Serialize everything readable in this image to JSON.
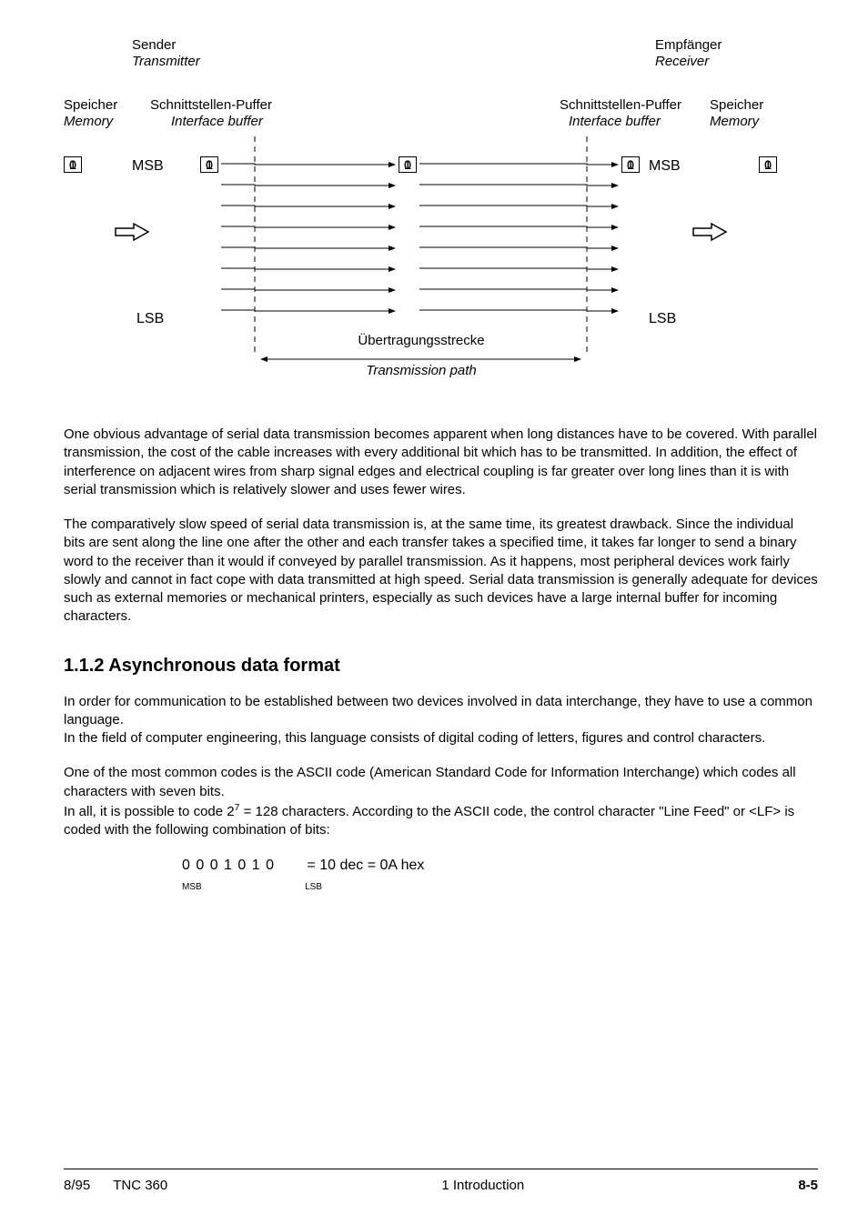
{
  "diagram": {
    "sender_de": "Sender",
    "sender_en": "Transmitter",
    "receiver_de": "Empfänger",
    "receiver_en": "Receiver",
    "memory_de": "Speicher",
    "memory_en": "Memory",
    "buffer_de": "Schnittstellen-Puffer",
    "buffer_en": "Interface buffer",
    "msb": "MSB",
    "lsb": "LSB",
    "path_de": "Übertragungsstrecke",
    "path_en": "Transmission path",
    "bits": [
      "0",
      "1",
      "1",
      "0",
      "1",
      "0",
      "1",
      "1"
    ]
  },
  "para1": "One obvious advantage of serial data transmission becomes apparent when long distances have to be covered. With parallel transmission, the cost of the cable increases with every additional bit which has to be transmitted. In addition, the effect of interference on adjacent wires from sharp signal edges and electrical coupling is far greater over long lines than it is with serial transmission which is relatively slower and uses fewer wires.",
  "para2": "The comparatively slow speed of serial data transmission is, at the same time, its greatest drawback. Since the individual bits are sent along the line one after the other and each transfer takes a specified time, it takes far longer to send a binary word to the receiver than it would if conveyed by parallel transmission. As it happens, most peripheral devices work fairly slowly and cannot in fact cope with data transmitted at high speed. Serial data transmission is generally adequate for devices such as external memories or mechanical printers, especially as such devices have a large internal buffer for incoming characters.",
  "heading": "1.1.2  Asynchronous data format",
  "para3a": "In order for communication to be established between two devices involved in data interchange, they have to use a common language.",
  "para3b": "In the field of computer engineering, this language consists of digital coding of letters, figures and control characters.",
  "para4a": "One of the most common codes is the ASCII code (American Standard Code for Information Interchange) which codes all characters with seven bits.",
  "para4b_pre": "In all, it is possible to code 2",
  "para4b_post": " = 128 characters. According to the ASCII code, the control character \"Line Feed\" or <LF> is coded with the following combination of bits:",
  "bitstring": "0  0  0  1  0  1  0",
  "bitresult": "=     10 dec  =  0A hex",
  "bit_msb": "MSB",
  "bit_lsb": "LSB",
  "footer": {
    "left": "8/95",
    "mid1": "TNC 360",
    "mid2": "1  Introduction",
    "right": "8-5"
  }
}
